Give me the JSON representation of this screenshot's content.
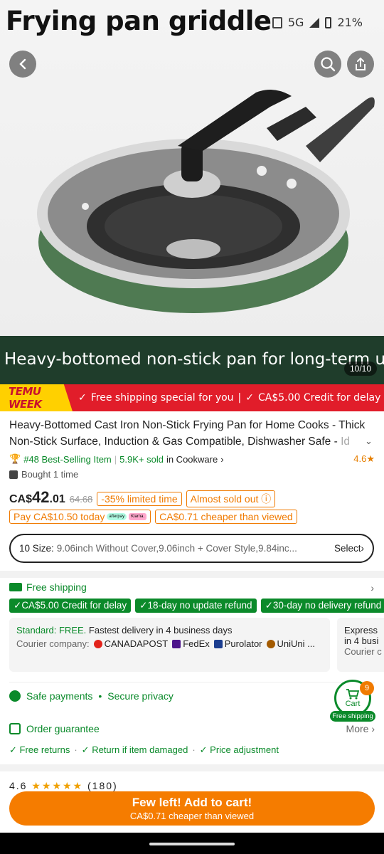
{
  "hero": {
    "title": "Frying pan griddle",
    "caption": "Heavy-bottomed non-stick pan for long-term use",
    "counter": "10/10"
  },
  "status_bar": {
    "network": "5G",
    "battery": "21%"
  },
  "banner": {
    "tag": "TEMU WEEK",
    "item1": "Free shipping special for you",
    "item2": "CA$5.00 Credit for delay"
  },
  "product": {
    "title": "Heavy-Bottomed Cast Iron Non-Stick Frying Pan for Home Cooks - Thick Non-Stick Surface, Induction & Gas Compatible, Dishwasher Safe - ",
    "title_more": "Id",
    "rank": "#48 Best-Selling Item",
    "sold": "5.9K+ sold",
    "category": "in Cookware",
    "rating": "4.6",
    "bought": "Bought 1 time",
    "price_currency": "CA$",
    "price_whole": "42",
    "price_cents": ".01",
    "price_old": "64.68",
    "discount": "-35% limited time",
    "stock": "Almost sold out",
    "pay_today": "Pay CA$10.50 today",
    "afterpay": "afterpay",
    "klarna": "Klarna.",
    "cheaper": "CA$0.71 cheaper than viewed"
  },
  "size": {
    "label": "10 Size:",
    "value": "9.06inch Without Cover,9.06inch + Cover Style,9.84inc...",
    "select": "Select"
  },
  "shipping": {
    "head": "Free shipping",
    "pills": [
      "CA$5.00 Credit for delay",
      "18-day no update refund",
      "30-day no delivery refund"
    ],
    "standard_label": "Standard: FREE.",
    "standard_text": "Fastest delivery in 4 business days",
    "courier_label": "Courier company:",
    "carriers": [
      "CANADAPOST",
      "FedEx",
      "Purolator",
      "UniUni ..."
    ],
    "express_label": "Express",
    "express_text": "in 4 busi",
    "express_courier": "Courier c"
  },
  "safety": {
    "payments": "Safe payments",
    "privacy": "Secure privacy"
  },
  "guarantee": {
    "title": "Order guarantee",
    "more": "More",
    "features": [
      "Free returns",
      "Return if item damaged",
      "Price adjustment"
    ]
  },
  "cart": {
    "count": "9",
    "label": "Cart",
    "free": "Free shipping"
  },
  "reviews_peek": {
    "rating": "4.6",
    "count": "(180)"
  },
  "cta": {
    "main": "Few left! Add to cart!",
    "sub": "CA$0.71 cheaper than viewed"
  },
  "colors": {
    "accent": "#f57c00",
    "green": "#0a8a2a",
    "banner_red": "#e11d2a",
    "banner_yellow": "#ffd000"
  }
}
